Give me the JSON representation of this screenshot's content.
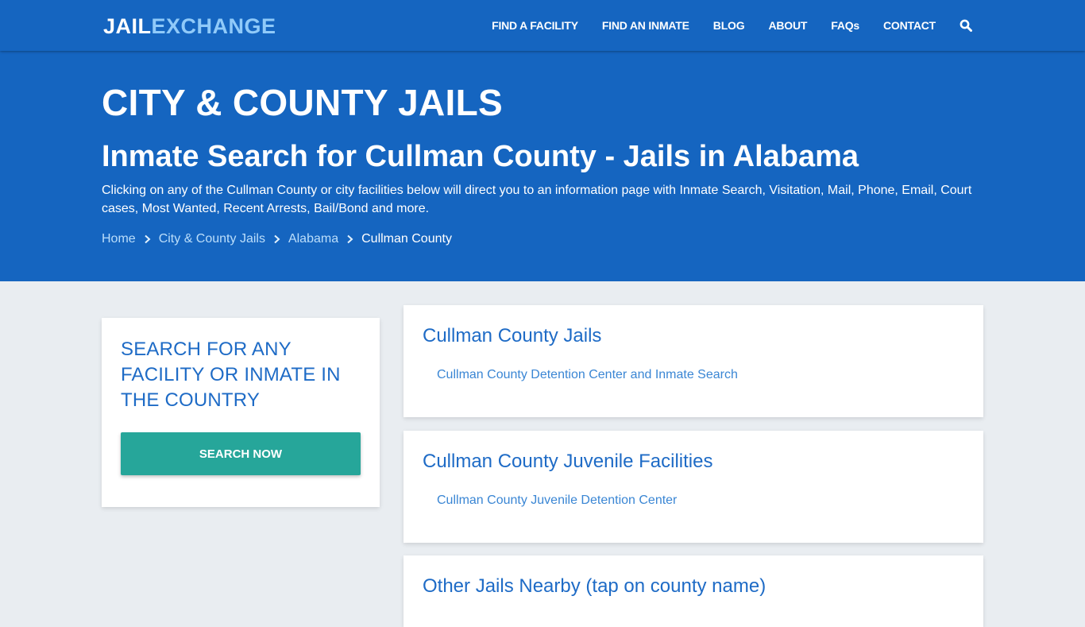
{
  "header": {
    "logo_part1": "JAIL",
    "logo_part2": "EXCHANGE",
    "nav": [
      "FIND A FACILITY",
      "FIND AN INMATE",
      "BLOG",
      "ABOUT",
      "FAQs",
      "CONTACT"
    ],
    "search_icon": "search-icon"
  },
  "hero": {
    "title": "CITY & COUNTY JAILS",
    "subtitle": "Inmate Search for Cullman County - Jails in Alabama",
    "description": "Clicking on any of the Cullman County or city facilities below will direct you to an information page with Inmate Search, Visitation, Mail, Phone, Email, Court cases, Most Wanted, Recent Arrests, Bail/Bond and more.",
    "breadcrumb": [
      "Home",
      "City & County Jails",
      "Alabama",
      "Cullman County"
    ]
  },
  "sidebar": {
    "heading": "SEARCH FOR ANY FACILITY OR INMATE IN THE COUNTRY",
    "button_label": "SEARCH NOW"
  },
  "sections": [
    {
      "title": "Cullman County Jails",
      "items": [
        "Cullman County Detention Center and Inmate Search"
      ]
    },
    {
      "title": "Cullman County Juvenile Facilities",
      "items": [
        "Cullman County Juvenile Detention Center"
      ]
    },
    {
      "title": "Other Jails Nearby (tap on county name)",
      "items": []
    }
  ],
  "colors": {
    "primary": "#1565c0",
    "accent_light": "#90caf9",
    "button": "#26a69a",
    "heading_blue": "#1e6bc6",
    "link_blue": "#3a86d4",
    "page_bg": "#e9edf1"
  }
}
